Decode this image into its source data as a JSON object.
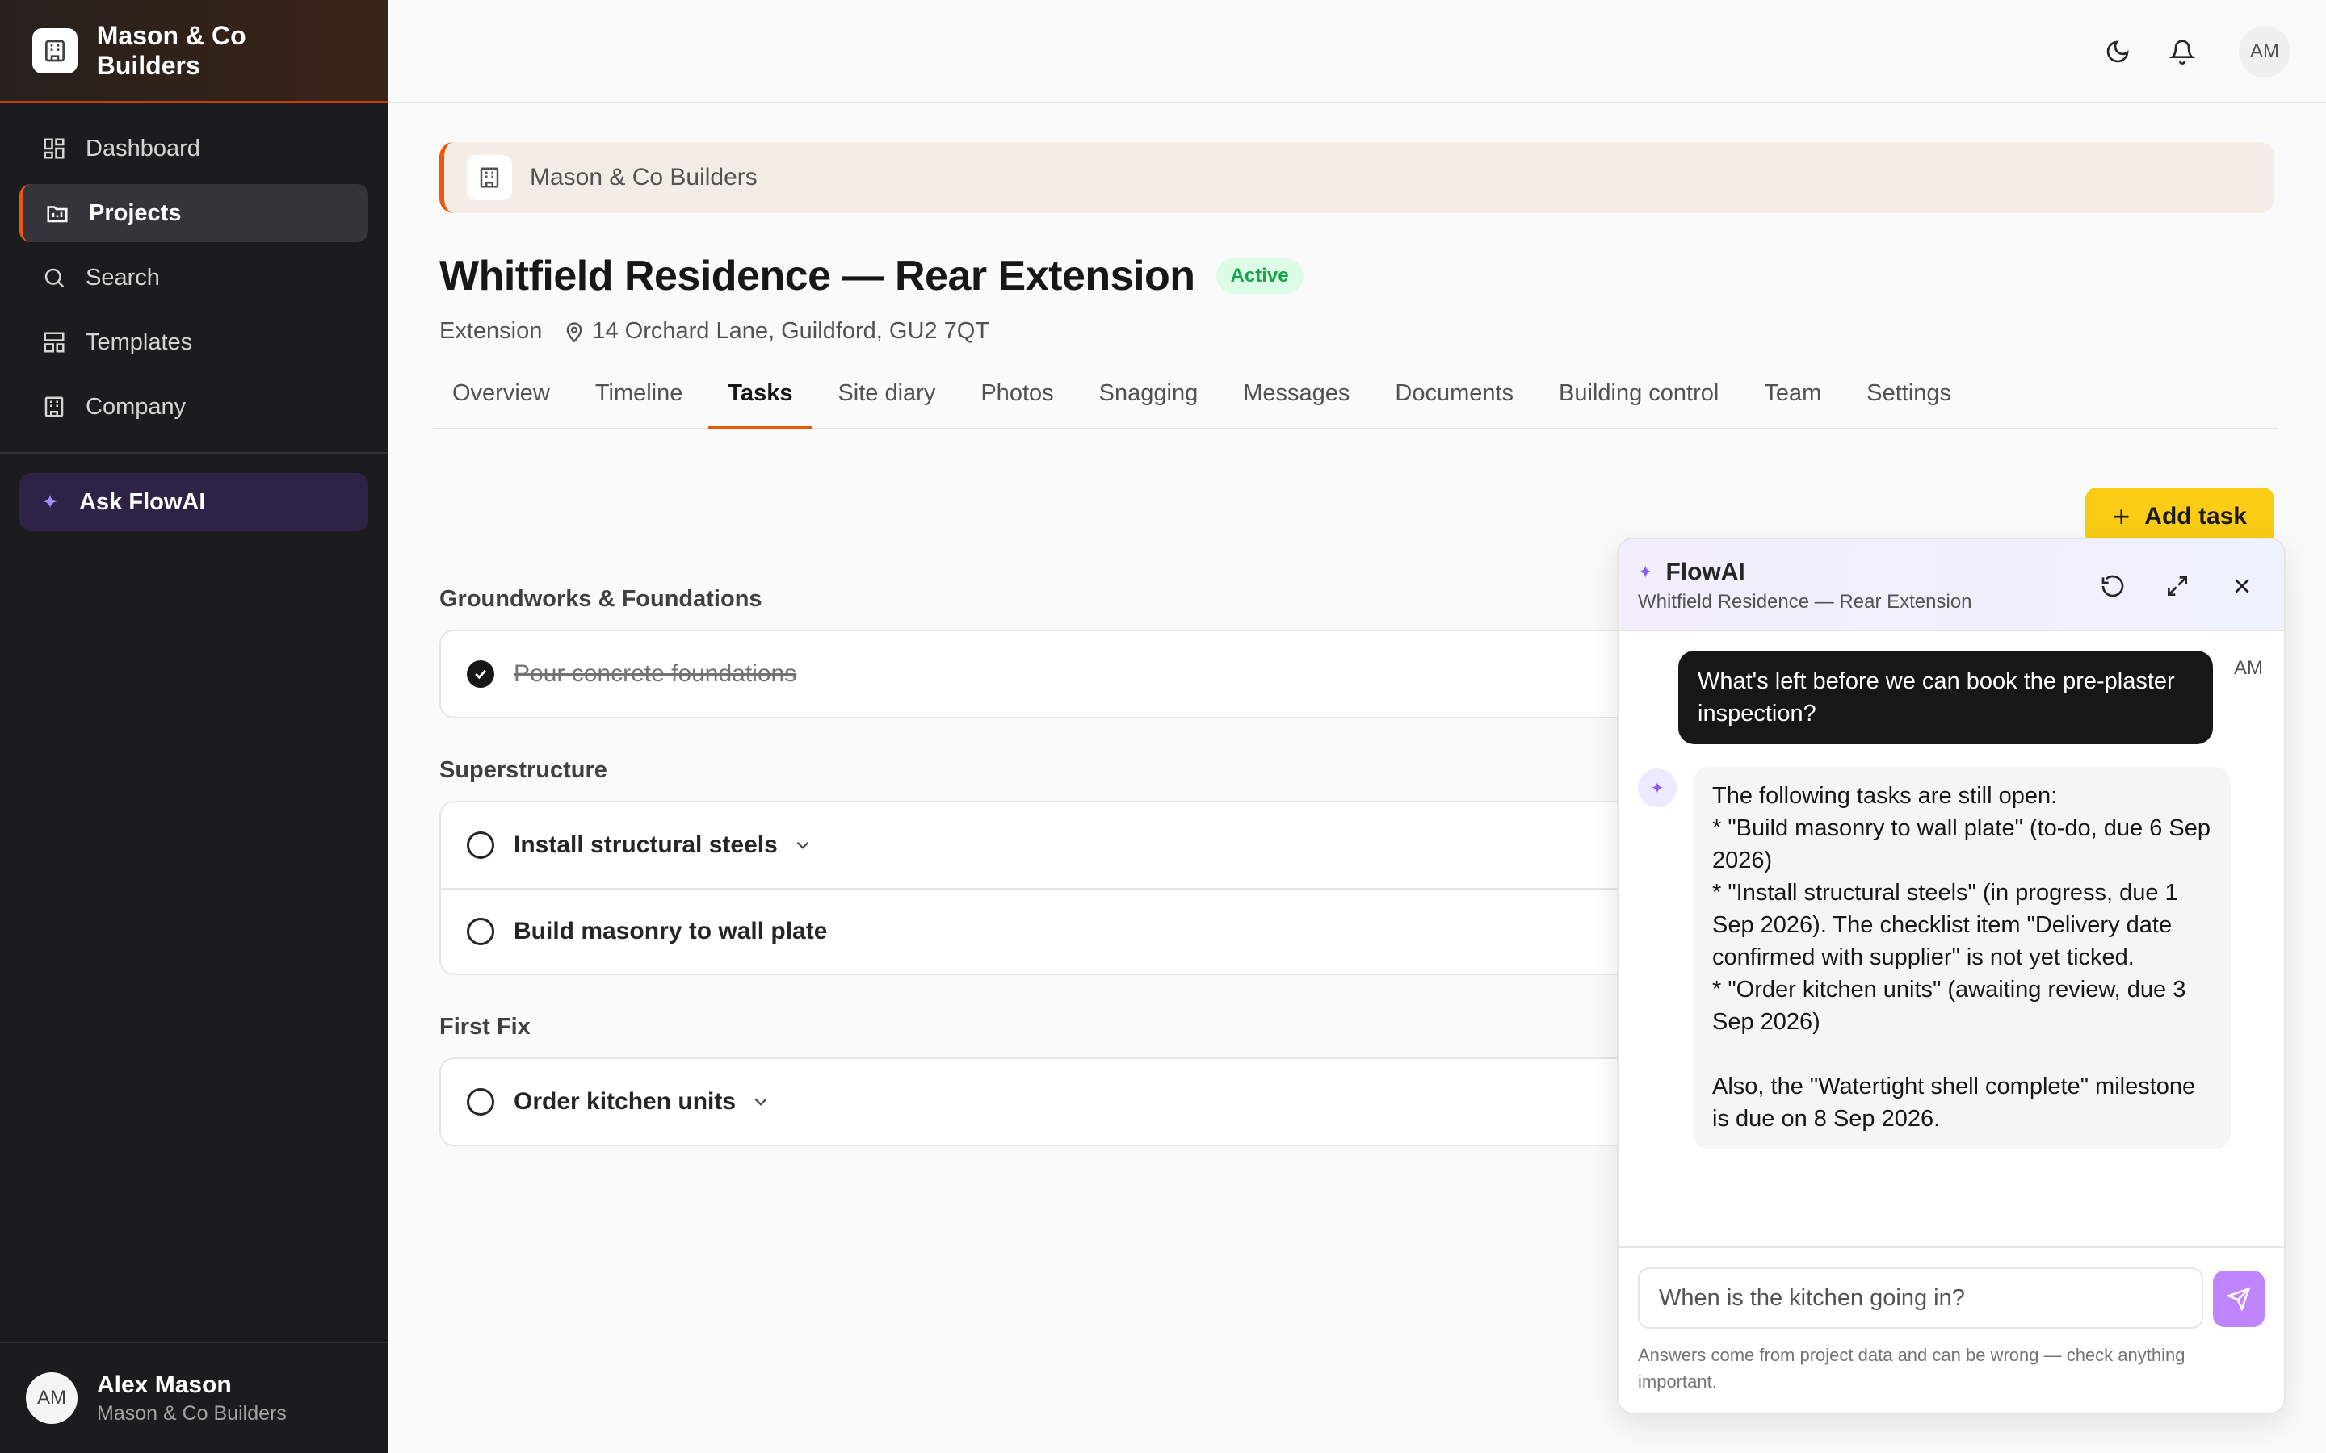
{
  "brand": {
    "name": "Mason & Co Builders"
  },
  "nav": {
    "items": [
      {
        "label": "Dashboard",
        "icon": "grid-icon"
      },
      {
        "label": "Projects",
        "icon": "folder-icon"
      },
      {
        "label": "Search",
        "icon": "search-icon"
      },
      {
        "label": "Templates",
        "icon": "layout-icon"
      },
      {
        "label": "Company",
        "icon": "building-icon"
      }
    ],
    "active": "Projects",
    "ask_label": "Ask FlowAI"
  },
  "user": {
    "initials": "AM",
    "name": "Alex Mason",
    "org": "Mason & Co Builders"
  },
  "topbar": {
    "avatar_initials": "AM"
  },
  "project": {
    "company": "Mason & Co Builders",
    "title": "Whitfield Residence — Rear Extension",
    "status": "Active",
    "type": "Extension",
    "address": "14 Orchard Lane, Guildford, GU2 7QT"
  },
  "tabs": [
    "Overview",
    "Timeline",
    "Tasks",
    "Site diary",
    "Photos",
    "Snagging",
    "Messages",
    "Documents",
    "Building control",
    "Team",
    "Settings"
  ],
  "active_tab": "Tasks",
  "add_task_label": "Add task",
  "groups": [
    {
      "title": "Groundworks & Foundations",
      "tasks": [
        {
          "label": "Pour concrete foundations",
          "done": true
        }
      ]
    },
    {
      "title": "Superstructure",
      "tasks": [
        {
          "label": "Install structural steels",
          "done": false
        },
        {
          "label": "Build masonry to wall plate",
          "done": false
        }
      ]
    },
    {
      "title": "First Fix",
      "tasks": [
        {
          "label": "Order kitchen units",
          "done": false
        }
      ]
    }
  ],
  "chat": {
    "title": "FlowAI",
    "subtitle": "Whitfield Residence — Rear Extension",
    "user_initials": "AM",
    "user_message": "What's left before we can book the pre-plaster inspection?",
    "ai_message": "The following tasks are still open:\n*   \"Build masonry to wall plate\" (to-do, due 6 Sep 2026)\n*   \"Install structural steels\" (in progress, due 1 Sep 2026). The checklist item \"Delivery date confirmed with supplier\" is not yet ticked.\n*   \"Order kitchen units\" (awaiting review, due 3 Sep 2026)\n\nAlso, the \"Watertight shell complete\" milestone is due on 8 Sep 2026.",
    "input_value": "When is the kitchen going in?",
    "disclaimer": "Answers come from project data and can be wrong — check anything important."
  },
  "colors": {
    "accent": "#ea580c",
    "primary_button": "#facc15",
    "ai": "#8b5cf6",
    "status_active": "#16a34a"
  }
}
